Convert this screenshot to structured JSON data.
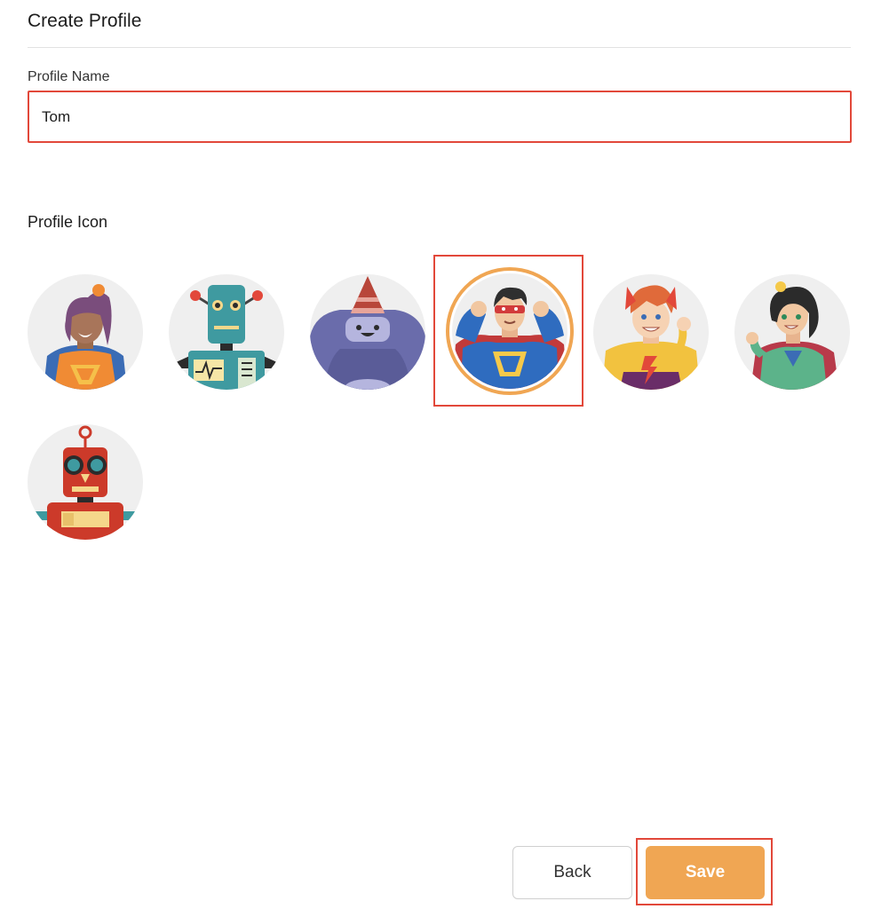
{
  "header": {
    "title": "Create Profile"
  },
  "form": {
    "name_label": "Profile Name",
    "name_value": "Tom",
    "icon_label": "Profile Icon"
  },
  "icons": [
    {
      "name": "hero-girl-ponytail",
      "selected": false
    },
    {
      "name": "teal-robot",
      "selected": false
    },
    {
      "name": "purple-monster-party-hat",
      "selected": false
    },
    {
      "name": "masked-superhero",
      "selected": true
    },
    {
      "name": "redhead-hero-boy",
      "selected": false
    },
    {
      "name": "hero-girl-green",
      "selected": false
    },
    {
      "name": "red-robot",
      "selected": false
    }
  ],
  "footer": {
    "back_label": "Back",
    "save_label": "Save"
  },
  "colors": {
    "accent": "#f0a653",
    "highlight": "#e2483a"
  }
}
